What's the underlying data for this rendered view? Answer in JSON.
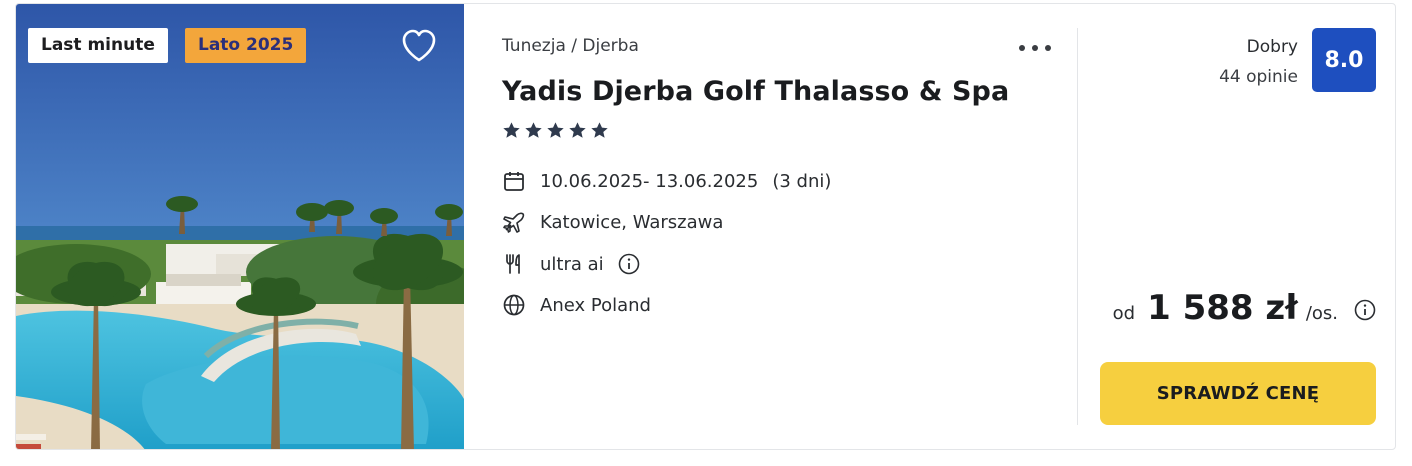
{
  "offer": {
    "badges": {
      "last_minute": "Last minute",
      "season": "Lato 2025"
    },
    "location": "Tunezja / Djerba",
    "hotel_name": "Yadis Djerba Golf Thalasso & Spa",
    "stars": 5,
    "dates": "10.06.2025- 13.06.2025",
    "duration": "(3 dni)",
    "departure": "Katowice, Warszawa",
    "board": "ultra ai",
    "operator": "Anex Poland",
    "rating": {
      "label": "Dobry",
      "reviews": "44 opinie",
      "score": "8.0"
    },
    "price": {
      "prefix": "od",
      "amount": "1 588 zł",
      "suffix": "/os."
    },
    "cta_label": "SPRAWDŹ CENĘ"
  },
  "icons": {
    "favorite": "heart-outline-icon",
    "menu": "more-dots-icon",
    "dates": "calendar-icon",
    "departure": "plane-icon",
    "board": "cutlery-icon",
    "operator": "globe-icon",
    "info": "info-icon"
  },
  "colors": {
    "season_badge": "#f3a63b",
    "score_bg": "#1e4fbf",
    "cta_bg": "#f6cf3f",
    "stars": "#2f3a4d"
  }
}
